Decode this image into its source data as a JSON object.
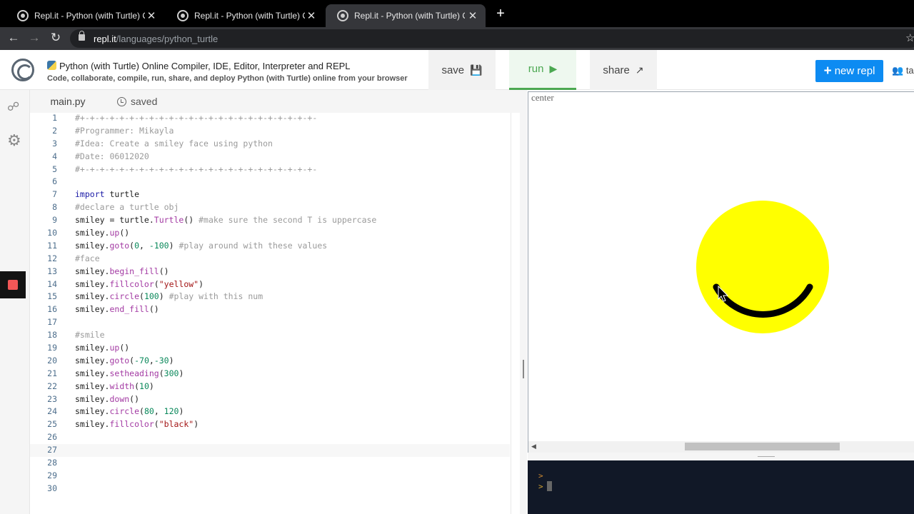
{
  "browser": {
    "tabs": [
      {
        "title": "Repl.it - Python (with Turtle) Online Compiler, IDE, Editor, Interpreter and REPL",
        "active": false
      },
      {
        "title": "Repl.it - Python (with Turtle) Online Compiler, IDE, Editor, Interpreter and REPL",
        "active": false
      },
      {
        "title": "Repl.it - Python (with Turtle) Online Compiler, IDE, Editor, Interpreter and REPL",
        "active": true
      }
    ],
    "close_glyph": "✕",
    "new_tab_glyph": "+",
    "url_host": "repl.it",
    "url_path": "/languages/python_turtle"
  },
  "header": {
    "title": "Python (with Turtle) Online Compiler, IDE, Editor, Interpreter and REPL",
    "subtitle": "Code, collaborate, compile, run, share, and deploy Python (with Turtle) online from your browser",
    "save_label": "save",
    "run_label": "run",
    "share_label": "share",
    "new_repl_label": "new repl",
    "teams_label": "ta"
  },
  "editor": {
    "file_tab": "main.py",
    "status": "saved",
    "current_line": 27,
    "lines": [
      "#+-+-+-+-+-+-+-+-+-+-+-+-+-+-+-+-+-+-+-+-+-+-+-+-",
      "#Programmer: Mikayla",
      "#Idea: Create a smiley face using python",
      "#Date: 06012020",
      "#+-+-+-+-+-+-+-+-+-+-+-+-+-+-+-+-+-+-+-+-+-+-+-+-",
      "",
      "import turtle",
      "#declare a turtle obj",
      "smiley = turtle.Turtle() #make sure the second T is uppercase",
      "smiley.up()",
      "smiley.goto(0, -100) #play around with these values",
      "#face",
      "smiley.begin_fill()",
      "smiley.fillcolor(\"yellow\")",
      "smiley.circle(100) #play with this num",
      "smiley.end_fill()",
      "",
      "#smile",
      "smiley.up()",
      "smiley.goto(-70,-30)",
      "smiley.setheading(300)",
      "smiley.width(10)",
      "smiley.down()",
      "smiley.circle(80, 120)",
      "smiley.fillcolor(\"black\")",
      "",
      "",
      "",
      "",
      ""
    ]
  },
  "output": {
    "canvas_label": "center",
    "face_color": "#ffff00",
    "smile_color": "#000000",
    "console_prompt": ">"
  },
  "icons": {
    "share_network": "share-network-icon",
    "settings": "gear-icon",
    "stop": "stop-icon"
  }
}
